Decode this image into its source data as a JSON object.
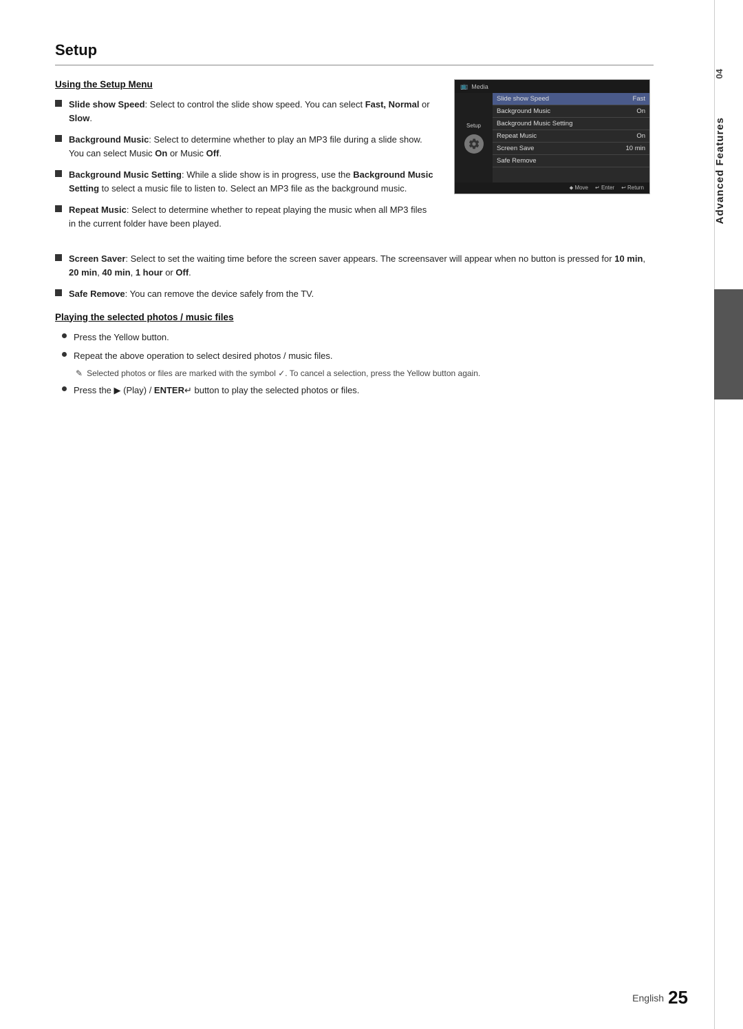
{
  "page": {
    "chapter_number": "04",
    "chapter_label": "Advanced Features",
    "footer_text": "English",
    "footer_page": "25"
  },
  "section": {
    "title": "Setup",
    "using_setup_menu_heading": "Using the Setup Menu",
    "bullets": [
      {
        "id": "slideshow-speed",
        "html": "<b>Slide show Speed</b>: Select to control the slide show speed. You can select <b>Fast, Normal</b> or <b>Slow</b>."
      },
      {
        "id": "background-music",
        "html": "<b>Background Music</b>: Select to determine whether to play an MP3 file during a slide show. You can select Music <b>On</b> or Music <b>Off</b>."
      },
      {
        "id": "background-music-setting",
        "html": "<b>Background Music Setting</b>: While a slide show is in progress, use the <b>Background Music Setting</b> to select a music file to listen to. Select an MP3 file as the background music."
      },
      {
        "id": "repeat-music",
        "html": "<b>Repeat Music</b>: Select to determine whether to repeat playing the music when all MP3 files in the current folder have been played."
      },
      {
        "id": "screen-saver",
        "html": "<b>Screen Saver</b>: Select to set the waiting time before the screen saver appears. The screensaver will appear when no button is pressed for <b>10 min</b>, <b>20 min</b>, <b>40 min</b>, <b>1 hour</b> or <b>Off</b>."
      },
      {
        "id": "safe-remove",
        "html": "<b>Safe Remove</b>: You can remove the device safely from the TV."
      }
    ],
    "playing_section_heading": "Playing the selected photos / music files",
    "playing_bullets": [
      "Press the Yellow button.",
      "Repeat the above operation to select desired photos / music files."
    ],
    "note_text": "Selected photos or files are marked with the symbol ✓. To cancel a selection, press the Yellow button again.",
    "play_bullet": "Press the ▶ (Play) / ENTER↵ button to play the selected photos or files."
  },
  "screen_mockup": {
    "header_label": "Media",
    "setup_label": "Setup",
    "rows": [
      {
        "label": "Slide show Speed",
        "value": "Fast",
        "highlighted": true
      },
      {
        "label": "Background Music",
        "value": "On",
        "highlighted": false
      },
      {
        "label": "Background Music Setting",
        "value": "",
        "highlighted": false
      },
      {
        "label": "Repeat Music",
        "value": "On",
        "highlighted": false
      },
      {
        "label": "Screen Save",
        "value": "10 min",
        "highlighted": false
      },
      {
        "label": "Safe Remove",
        "value": "",
        "highlighted": false
      }
    ],
    "bottom_controls": [
      "⬥ Move",
      "↵ Enter",
      "↩ Return"
    ]
  }
}
